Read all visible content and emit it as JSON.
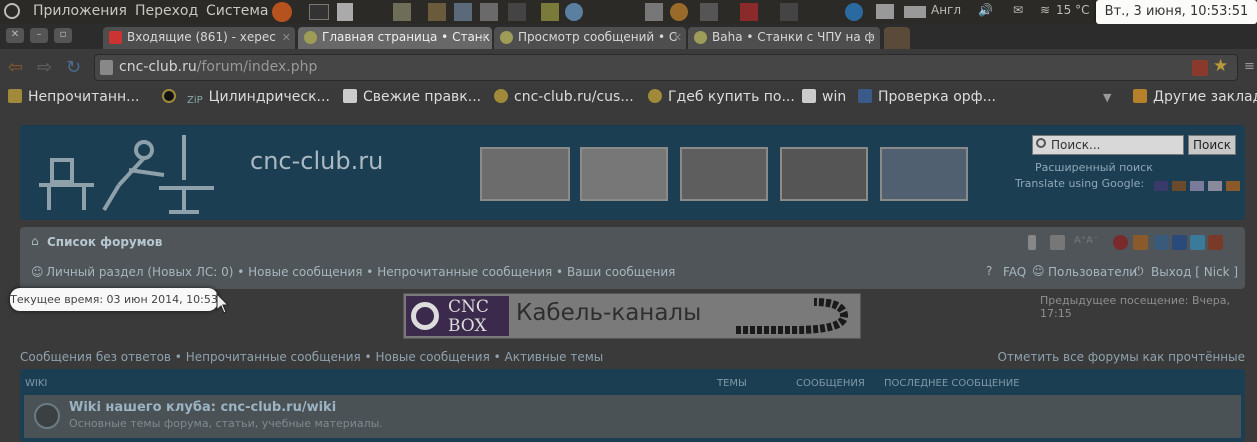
{
  "top_panel": {
    "menus": [
      "Приложения",
      "Переход",
      "Система"
    ],
    "keyboard_layout": "Англ",
    "temperature": "15 °C",
    "clock": "Вт., 3 июня, 10:53:51"
  },
  "tabs": [
    {
      "label": "Входящие (861) - херес",
      "icon": "gmail-icon",
      "active": false
    },
    {
      "label": "Главная страница • Станк",
      "icon": "forum-icon",
      "active": true
    },
    {
      "label": "Просмотр сообщений • С",
      "icon": "forum-icon",
      "active": false
    },
    {
      "label": "Baha • Станки с ЧПУ на ф",
      "icon": "forum-icon",
      "active": false
    }
  ],
  "address_bar": {
    "host": "cnc-club.ru",
    "path": "/forum/index.php"
  },
  "bookmarks": [
    {
      "label": "Непрочитанн...",
      "icon": "bookmark-icon"
    },
    {
      "label": "",
      "icon": "vinyl-icon"
    },
    {
      "label": "Цилиндрическ...",
      "icon": "zip-icon"
    },
    {
      "label": "Свежие правк...",
      "icon": "page-icon"
    },
    {
      "label": "cnc-club.ru/cus...",
      "icon": "forum-icon"
    },
    {
      "label": "Гдеб купить по...",
      "icon": "forum-icon"
    },
    {
      "label": "win",
      "icon": "page-icon"
    },
    {
      "label": "Проверка орф...",
      "icon": "spell-icon"
    }
  ],
  "other_bookmarks": "Другие заклад",
  "forum": {
    "site_title": "cnc-club.ru",
    "search_placeholder": "Поиск...",
    "search_button": "Поиск",
    "advanced_search": "Расширенный поиск",
    "translate": "Translate using Google:",
    "forum_list": "Список форумов",
    "user_links": "Личный раздел (Новых ЛС: 0) • Новые сообщения • Непрочитанные сообщения • Ваши сообщения",
    "faq": "FAQ",
    "users": "Пользователи",
    "logout": "Выход [ Nick ]",
    "current_time": "Текущее время: 03 июн 2014, 10:53",
    "last_visit": "Предыдущее посещение: Вчера, 17:15",
    "banner_logo_line1": "CNC",
    "banner_logo_line2": "BOX",
    "banner_text": "Кабель-каналы",
    "quick_links": "Сообщения без ответов • Непрочитанные сообщения • Новые сообщения • Активные темы",
    "mark_read": "Отметить все форумы как прочтённые",
    "table": {
      "section": "WIKI",
      "col_topics": "ТЕМЫ",
      "col_posts": "СООБЩЕНИЯ",
      "col_last": "ПОСЛЕДНЕЕ СООБЩЕНИЕ"
    },
    "forum_name": "Wiki нашего клуба: cnc-club.ru/wiki",
    "forum_desc": "Основные темы форума, статьи, учебные материалы."
  }
}
